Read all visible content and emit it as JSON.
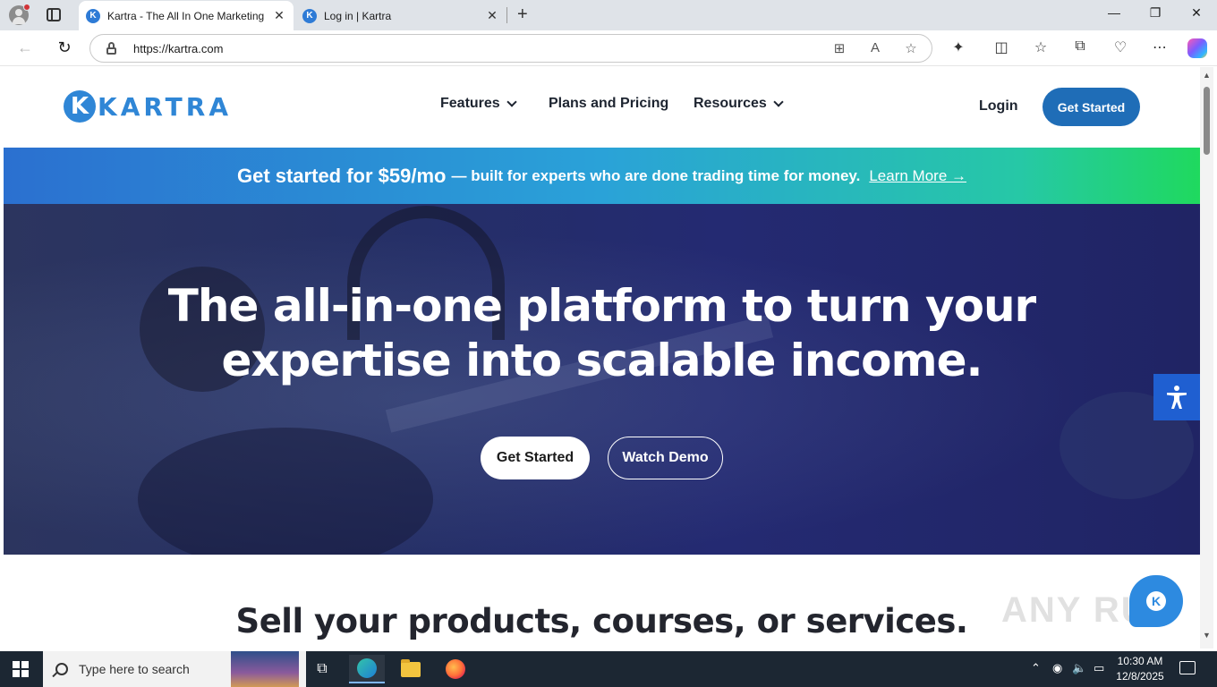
{
  "browser": {
    "tabs": [
      {
        "title": "Kartra - The All In One Marketing",
        "active": true,
        "favicon": "K"
      },
      {
        "title": "Log in | Kartra",
        "active": false,
        "favicon": "K"
      }
    ],
    "new_tab_symbol": "+",
    "close_symbol": "✕",
    "url": "https://kartra.com",
    "window_controls": {
      "minimize": "—",
      "restore": "❐",
      "close": "✕"
    },
    "nav": {
      "back": "←",
      "refresh": "↻"
    }
  },
  "site": {
    "logo_mark": "K",
    "logo_text": "KARTRA",
    "nav": [
      {
        "label": "Features",
        "has_dropdown": true
      },
      {
        "label": "Plans and Pricing",
        "has_dropdown": false
      },
      {
        "label": "Resources",
        "has_dropdown": true
      }
    ],
    "login_label": "Login",
    "get_started_label": "Get Started",
    "promo": {
      "main": "Get started for $59/mo",
      "sub": "— built for experts who are done trading time for money.",
      "link": "Learn More →"
    },
    "hero": {
      "headline_line1": "The all-in-one platform to turn your",
      "headline_line2": "expertise into scalable income.",
      "primary_button": "Get Started",
      "secondary_button": "Watch Demo"
    },
    "section_title": "Sell your products, courses, or services.",
    "chat_mark": "K",
    "watermark": "ANY RUN"
  },
  "taskbar": {
    "search_placeholder": "Type here to search",
    "time": "10:30 AM",
    "date": "12/8/2025"
  },
  "colors": {
    "brand_blue": "#1f6db7",
    "logo_blue": "#2f86d6",
    "promo_gradient_start": "#2b70d0",
    "promo_gradient_end": "#1fd95e",
    "hero_bg": "#242a72",
    "accessibility_blue": "#1f5fd1"
  }
}
